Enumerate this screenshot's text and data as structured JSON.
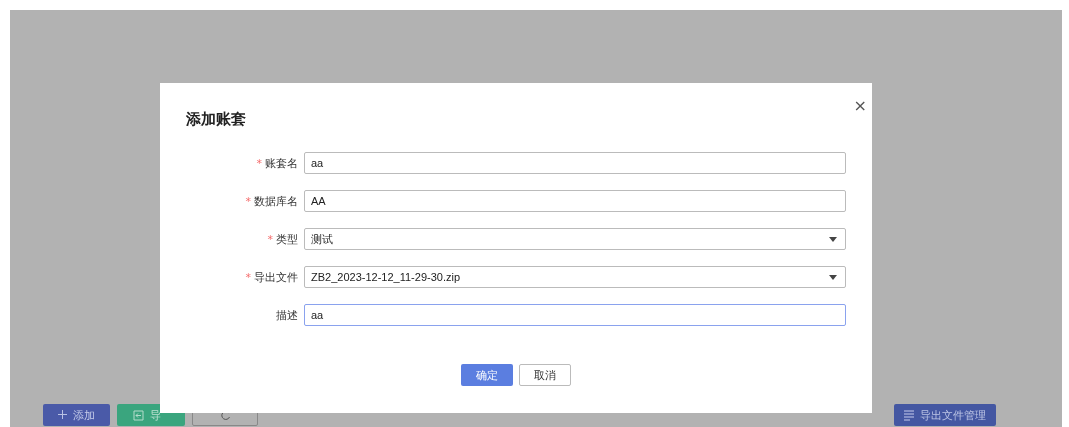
{
  "toolbar": [
    {
      "label": "添加",
      "kind": "add"
    },
    {
      "label": "导",
      "kind": "import"
    },
    {
      "kind": "refresh"
    }
  ],
  "toolbar_right": {
    "label": "导出文件管理"
  },
  "dialog": {
    "title": "添加账套",
    "close": "×",
    "fields": [
      {
        "label": "账套名",
        "required_mark": "*",
        "kind": "text",
        "value": "aa",
        "focused": false
      },
      {
        "label": "数据库名",
        "required_mark": "*",
        "kind": "text",
        "value": "AA",
        "focused": false
      },
      {
        "label": "类型",
        "required_mark": "*",
        "kind": "select",
        "value": "测试",
        "focused": false
      },
      {
        "label": "导出文件",
        "required_mark": "*",
        "kind": "select",
        "value": "ZB2_2023-12-12_11-29-30.zip",
        "focused": false
      },
      {
        "label": "描述",
        "kind": "text",
        "value": "aa",
        "focused": true
      }
    ],
    "buttons": [
      {
        "label": "确定",
        "kind": "primary"
      },
      {
        "label": "取消",
        "kind": "default"
      }
    ]
  }
}
